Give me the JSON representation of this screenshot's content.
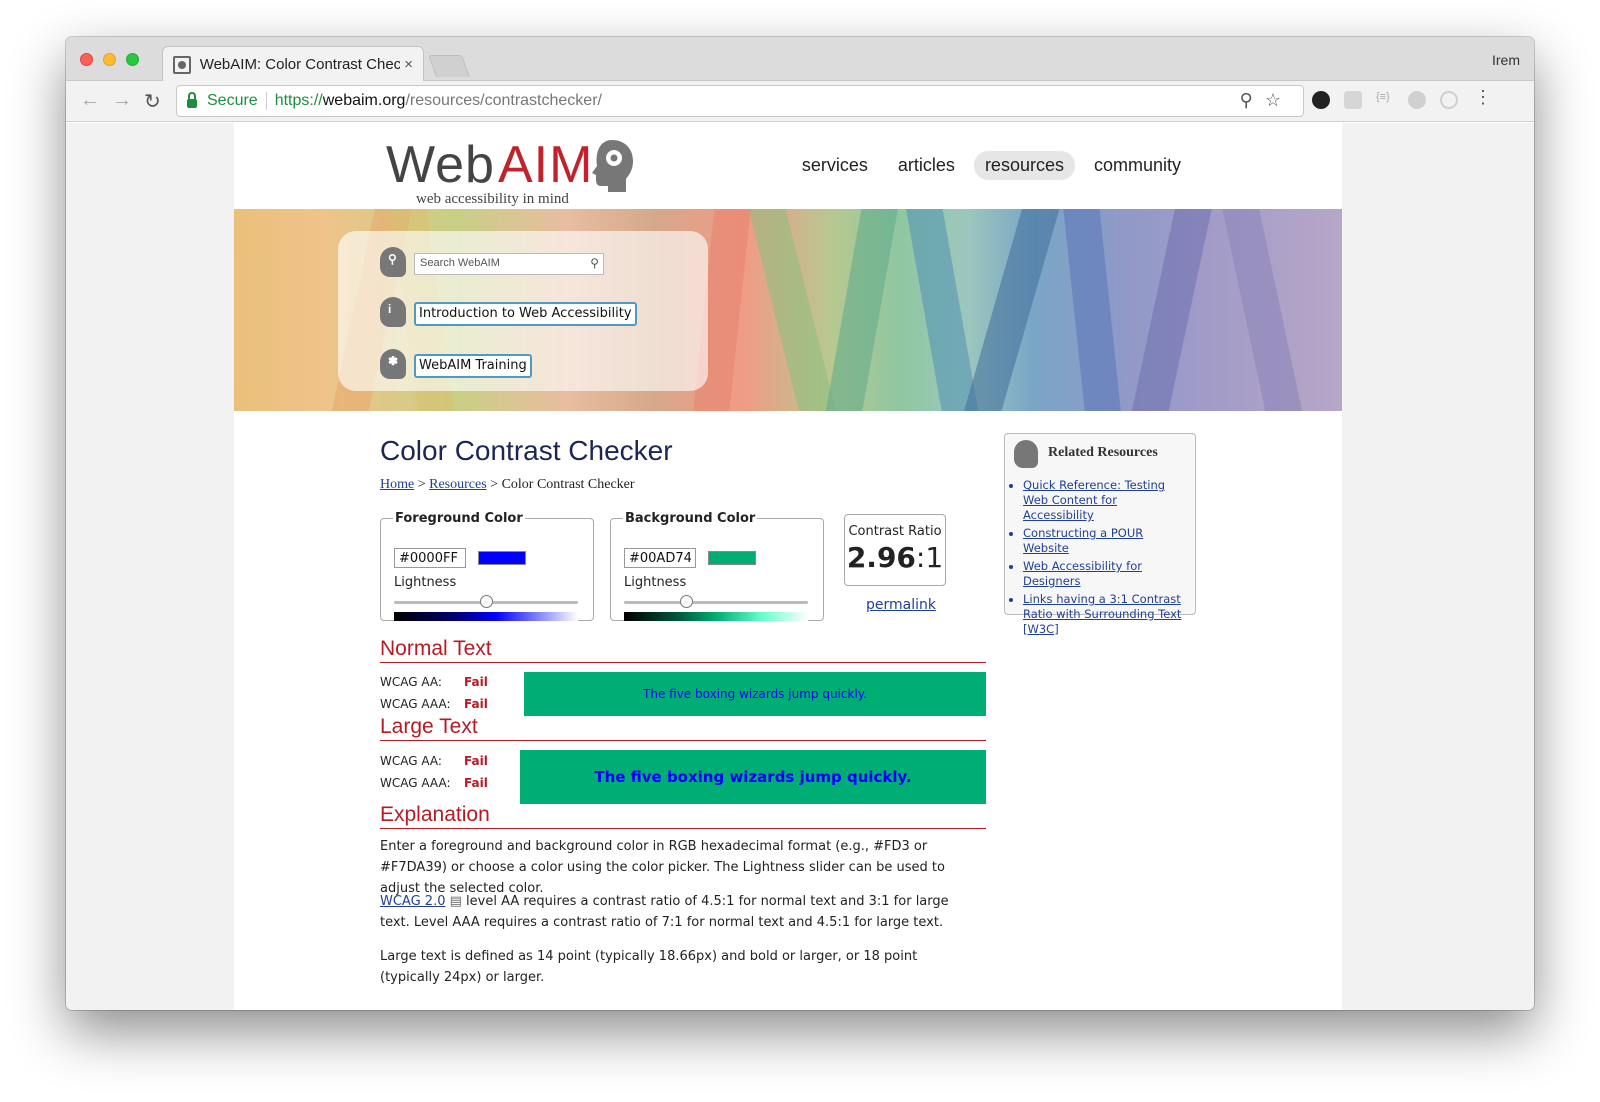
{
  "browser": {
    "tab_title": "WebAIM: Color Contrast Checker",
    "tab_close": "×",
    "profile_name": "Irem",
    "secure_label": "Secure",
    "url_scheme": "https://",
    "url_host": "webaim.org",
    "url_path": "/resources/contrastchecker/"
  },
  "site": {
    "logo_web": "Web",
    "logo_aim": "AIM",
    "logo_tagline": "web accessibility in mind",
    "nav": [
      "services",
      "articles",
      "resources",
      "community"
    ],
    "nav_active": "resources",
    "search_placeholder": "Search WebAIM",
    "intro_link": "Introduction to Web Accessibility",
    "training_link": "WebAIM Training"
  },
  "checker": {
    "title": "Color Contrast Checker",
    "breadcrumb": {
      "home": "Home",
      "sep1": " > ",
      "resources": "Resources",
      "sep2": " > ",
      "current": "Color Contrast Checker"
    },
    "foreground": {
      "legend": "Foreground Color",
      "hex": "#0000FF",
      "lightness_label": "Lightness",
      "lightness_value": 0.5
    },
    "background": {
      "legend": "Background Color",
      "hex": "#00AD74",
      "lightness_label": "Lightness",
      "lightness_value": 0.34
    },
    "ratio_label": "Contrast Ratio",
    "ratio_value": "2.96",
    "ratio_suffix": ":1",
    "permalink": "permalink"
  },
  "results": {
    "normal_heading": "Normal Text",
    "normal_aa_label": "WCAG AA:",
    "normal_aa_result": "Fail",
    "normal_aaa_label": "WCAG AAA:",
    "normal_aaa_result": "Fail",
    "normal_sample": "The five boxing wizards jump quickly.",
    "large_heading": "Large Text",
    "large_aa_label": "WCAG AA:",
    "large_aa_result": "Fail",
    "large_aaa_label": "WCAG AAA:",
    "large_aaa_result": "Fail",
    "large_sample": "The five boxing wizards jump quickly."
  },
  "explanation": {
    "heading": "Explanation",
    "p1": "Enter a foreground and background color in RGB hexadecimal format (e.g., #FD3 or #F7DA39) or choose a color using the color picker. The Lightness slider can be used to adjust the selected color.",
    "p2_link": "WCAG 2.0",
    "p2_text": " level AA requires a contrast ratio of 4.5:1 for normal text and 3:1 for large text. Level AAA requires a contrast ratio of 7:1 for normal text and 4.5:1 for large text.",
    "p3": "Large text is defined as 14 point (typically 18.66px) and bold or larger, or 18 point (typically 24px) or larger."
  },
  "related": {
    "title": "Related Resources",
    "items": [
      "Quick Reference: Testing Web Content for Accessibility",
      "Constructing a POUR Website",
      "Web Accessibility for Designers",
      "Links having a 3:1 Contrast Ratio with Surrounding Text [W3C]"
    ]
  },
  "colors": {
    "foreground": "#0000FF",
    "background": "#00AD74",
    "heading_red": "#b51b25",
    "link_blue": "#1f3f98"
  }
}
